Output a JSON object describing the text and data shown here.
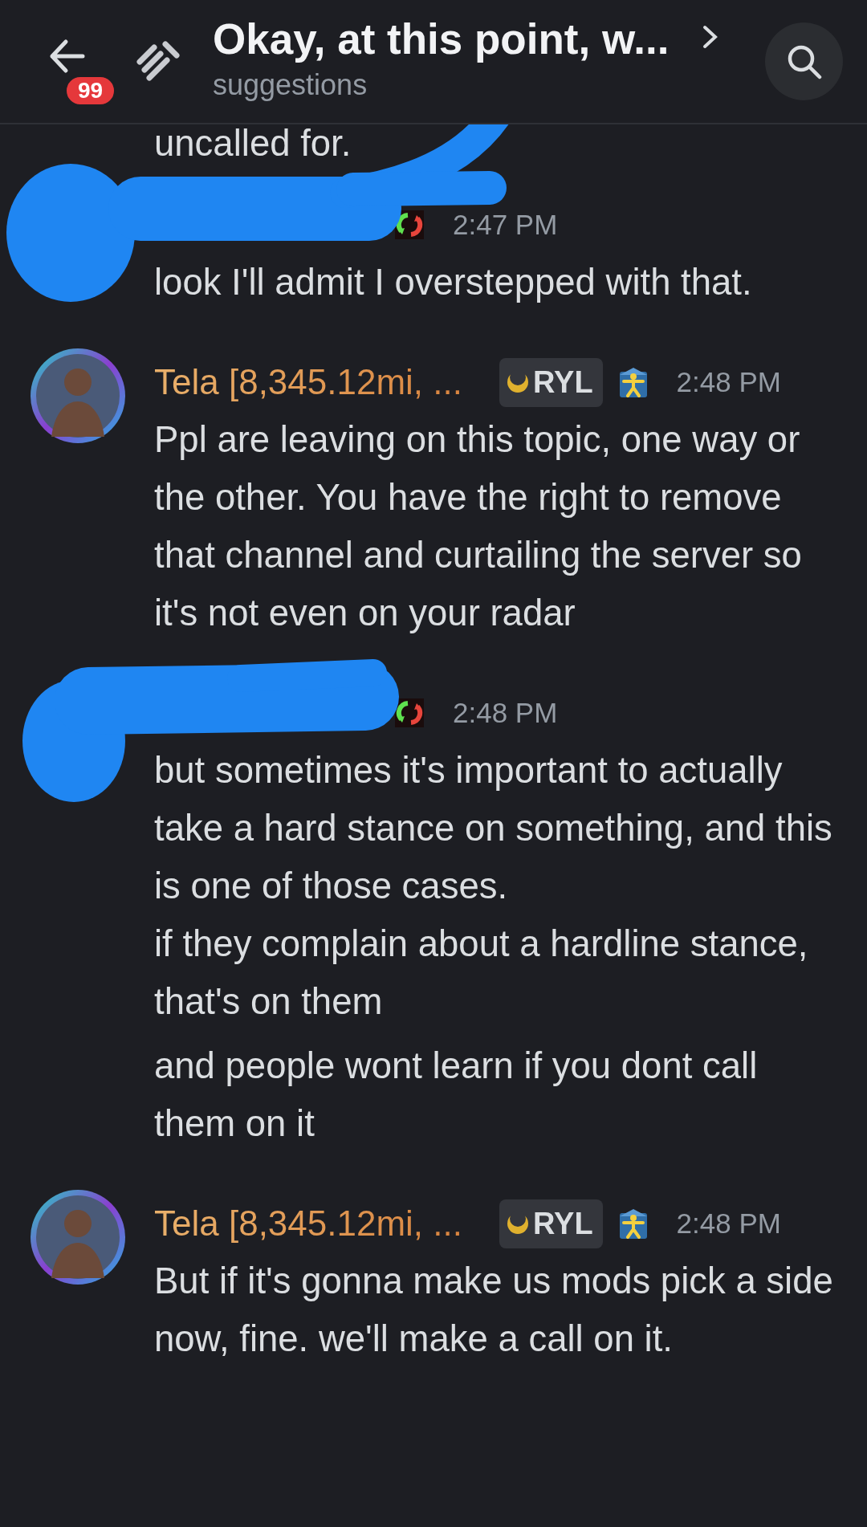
{
  "header": {
    "unread_badge": "99",
    "title": "Okay, at this point, w...",
    "channel": "suggestions"
  },
  "messages": [
    {
      "kind": "continued",
      "paragraphs": [
        "uncalled for."
      ]
    },
    {
      "kind": "redacted",
      "time": "2:47 PM",
      "paragraphs": [
        "look I'll admit I overstepped with that."
      ]
    },
    {
      "kind": "normal",
      "author": "Tela [8,345.12mi, ...",
      "tag": "RYL",
      "time": "2:48 PM",
      "paragraphs": [
        "Ppl are leaving on this topic, one way or the other. You have the right to remove that channel and curtailing the server so it's not even on your radar"
      ]
    },
    {
      "kind": "redacted",
      "time": "2:48 PM",
      "paragraphs": [
        "but sometimes it's important to actually take a hard stance on something, and this is one of those cases.",
        "if they complain about a hardline stance, that's on them",
        "and people wont learn if you dont call them on it"
      ]
    },
    {
      "kind": "normal",
      "author": "Tela [8,345.12mi, ...",
      "tag": "RYL",
      "time": "2:48 PM",
      "paragraphs": [
        "But if it's gonna make us mods pick a side now, fine. we'll make a call on it."
      ]
    }
  ]
}
